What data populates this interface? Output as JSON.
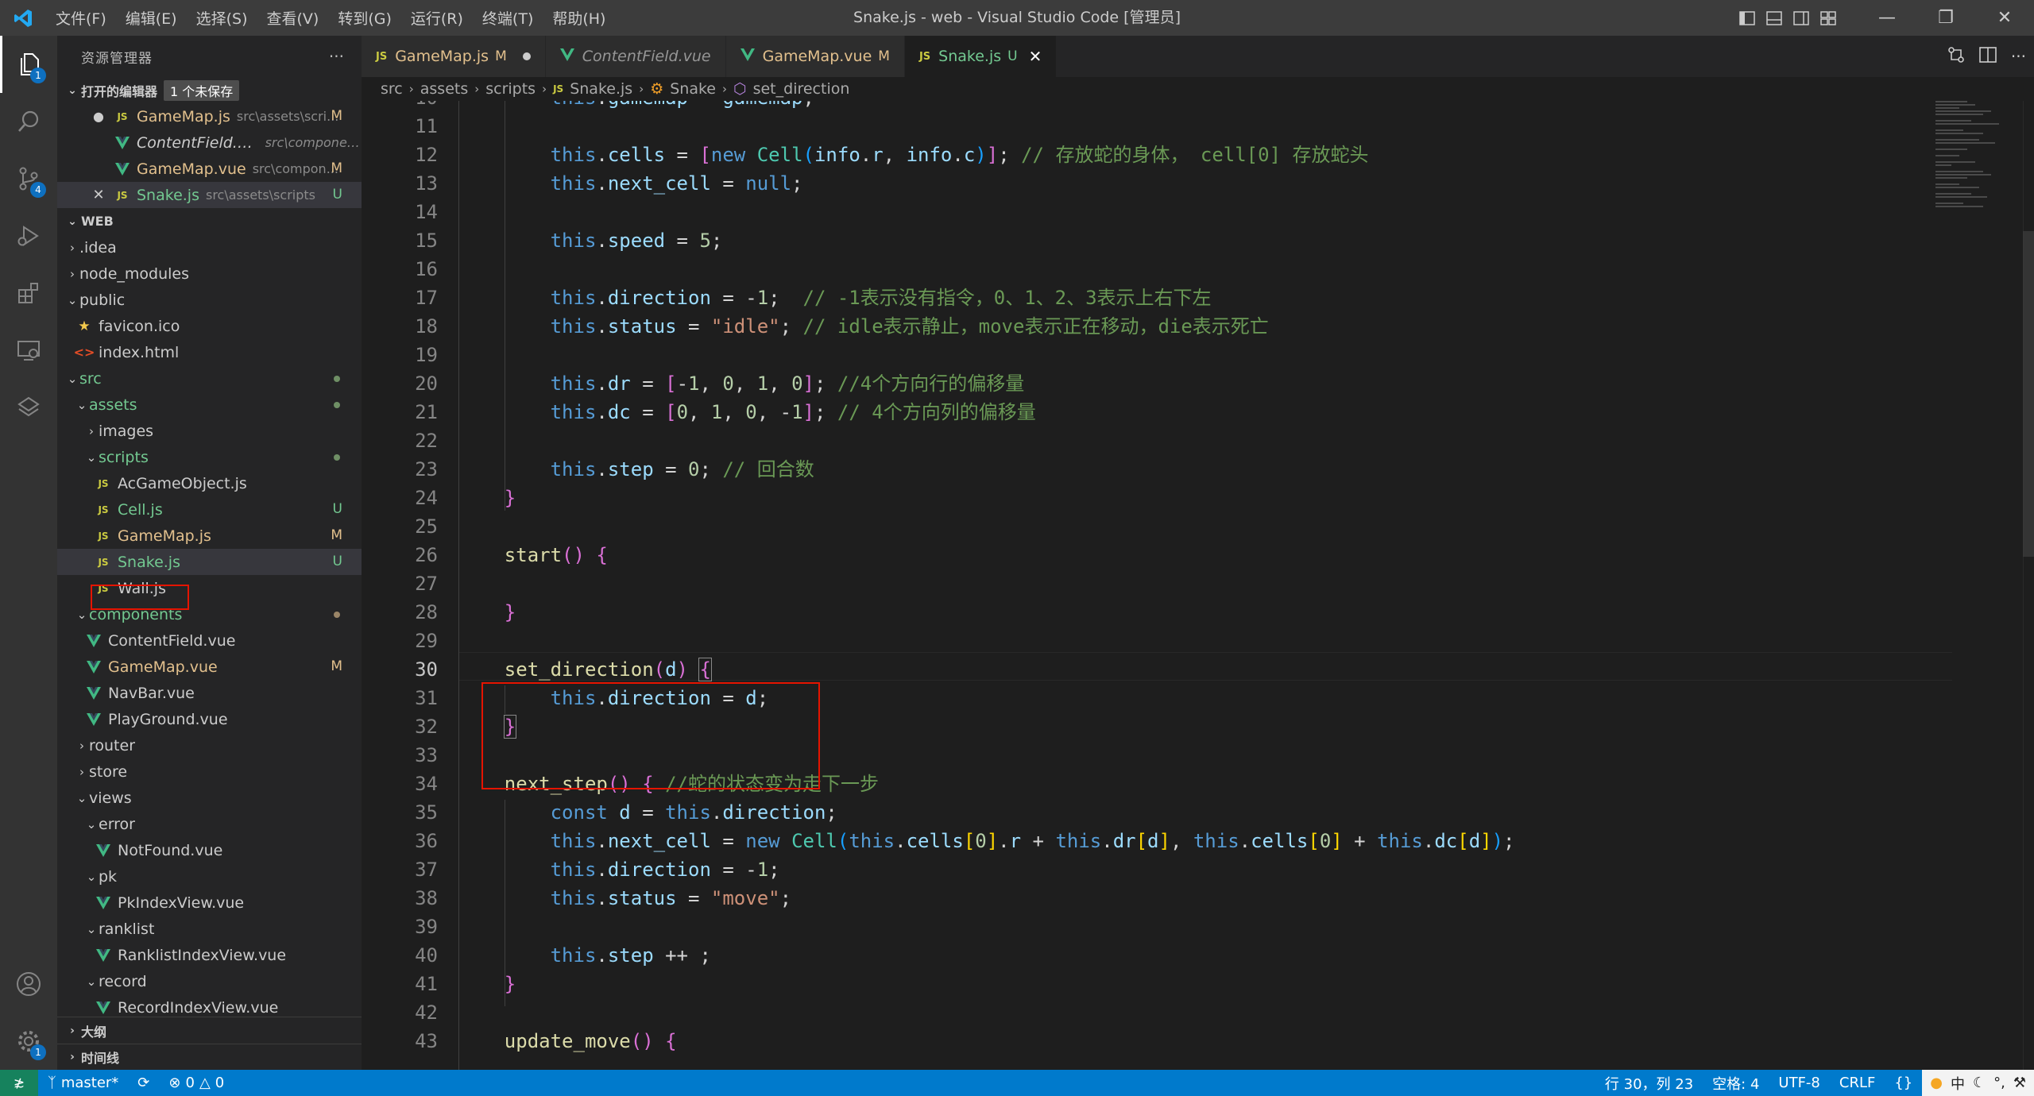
{
  "titlebar": {
    "title": "Snake.js - web - Visual Studio Code [管理员]",
    "menu": [
      "文件(F)",
      "编辑(E)",
      "选择(S)",
      "查看(V)",
      "转到(G)",
      "运行(R)",
      "终端(T)",
      "帮助(H)"
    ]
  },
  "activity": {
    "explorer_badge": "1",
    "scm_badge": "4",
    "settings_badge": "1"
  },
  "sidebar": {
    "header": "资源管理器",
    "more": "···",
    "open_editors": {
      "title": "打开的编辑器",
      "unsaved": "1 个未保存",
      "items": [
        {
          "name": "GameMap.js",
          "path": "src\\assets\\scri...",
          "status": "M"
        },
        {
          "name": "ContentField.vue",
          "path": "src\\components",
          "status": ""
        },
        {
          "name": "GameMap.vue",
          "path": "src\\compon...",
          "status": "M"
        },
        {
          "name": "Snake.js",
          "path": "src\\assets\\scripts",
          "status": "U"
        }
      ]
    },
    "workspace": {
      "title": "WEB",
      "items": [
        {
          "label": ".idea",
          "status": ""
        },
        {
          "label": "node_modules",
          "status": ""
        },
        {
          "label": "public",
          "status": ""
        },
        {
          "label": "favicon.ico",
          "status": ""
        },
        {
          "label": "index.html",
          "status": ""
        },
        {
          "label": "src",
          "status": ""
        },
        {
          "label": "assets",
          "status": ""
        },
        {
          "label": "images",
          "status": ""
        },
        {
          "label": "scripts",
          "status": ""
        },
        {
          "label": "AcGameObject.js",
          "status": ""
        },
        {
          "label": "Cell.js",
          "status": "U"
        },
        {
          "label": "GameMap.js",
          "status": "M"
        },
        {
          "label": "Snake.js",
          "status": "U"
        },
        {
          "label": "Wall.js",
          "status": ""
        },
        {
          "label": "components",
          "status": ""
        },
        {
          "label": "ContentField.vue",
          "status": ""
        },
        {
          "label": "GameMap.vue",
          "status": "M"
        },
        {
          "label": "NavBar.vue",
          "status": ""
        },
        {
          "label": "PlayGround.vue",
          "status": ""
        },
        {
          "label": "router",
          "status": ""
        },
        {
          "label": "store",
          "status": ""
        },
        {
          "label": "views",
          "status": ""
        },
        {
          "label": "error",
          "status": ""
        },
        {
          "label": "NotFound.vue",
          "status": ""
        },
        {
          "label": "pk",
          "status": ""
        },
        {
          "label": "PkIndexView.vue",
          "status": ""
        },
        {
          "label": "ranklist",
          "status": ""
        },
        {
          "label": "RanklistIndexView.vue",
          "status": ""
        },
        {
          "label": "record",
          "status": ""
        },
        {
          "label": "RecordIndexView.vue",
          "status": ""
        }
      ]
    },
    "outline": "大纲",
    "timeline": "时间线"
  },
  "tabs": [
    {
      "icon": "JS",
      "label": "GameMap.js",
      "status": "M"
    },
    {
      "icon": "V",
      "label": "ContentField.vue",
      "status": ""
    },
    {
      "icon": "V",
      "label": "GameMap.vue",
      "status": "M"
    },
    {
      "icon": "JS",
      "label": "Snake.js",
      "status": "U"
    }
  ],
  "breadcrumb": [
    "src",
    "assets",
    "scripts",
    "Snake.js",
    "Snake",
    "set_direction"
  ],
  "code": {
    "line_numbers": [
      "10",
      "11",
      "12",
      "13",
      "14",
      "15",
      "16",
      "17",
      "18",
      "19",
      "20",
      "21",
      "22",
      "23",
      "24",
      "25",
      "26",
      "27",
      "28",
      "29",
      "30",
      "31",
      "32",
      "33",
      "34",
      "35",
      "36",
      "37",
      "38",
      "39",
      "40",
      "41",
      "42",
      "43"
    ],
    "current_line": "30"
  },
  "statusbar": {
    "branch": "master*",
    "errors": "0",
    "warnings": "0",
    "position": "行 30，列 23",
    "spaces": "空格: 4",
    "encoding": "UTF-8",
    "eol": "CRLF",
    "lang": "{}",
    "ime": "中"
  }
}
